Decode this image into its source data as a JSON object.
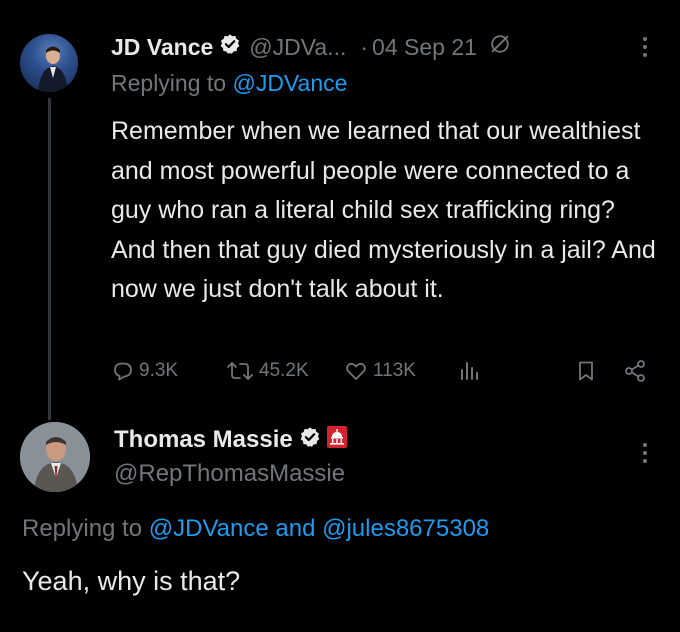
{
  "tweet1": {
    "name": "JD Vance",
    "handle": "@JDVa...",
    "separator": "·",
    "date": "04 Sep 21",
    "replying_prefix": "Replying to",
    "replying_to": "@JDVance",
    "text": "Remember when we learned that our wealthiest and most powerful people were connected to a guy who ran a literal child sex trafficking ring? And then that guy died mysteriously in a jail? And now we just don't talk about it.",
    "replies": "9.3K",
    "retweets": "45.2K",
    "likes": "113K"
  },
  "tweet2": {
    "name": "Thomas Massie",
    "handle": "@RepThomasMassie",
    "replying_prefix": "Replying to",
    "replying_to_1": "@JDVance",
    "replying_and": "and",
    "replying_to_2": "@jules8675308",
    "text": "Yeah, why is that?"
  },
  "colors": {
    "accent": "#1d9bf0",
    "muted": "#71767b",
    "text": "#e7e9ea",
    "background": "#000000",
    "badge_red": "#d3232f"
  },
  "icons": [
    "verified-badge-icon",
    "edited-icon",
    "more-icon",
    "reply-icon",
    "retweet-icon",
    "like-icon",
    "views-icon",
    "bookmark-icon",
    "share-icon",
    "capitol-badge-icon"
  ]
}
